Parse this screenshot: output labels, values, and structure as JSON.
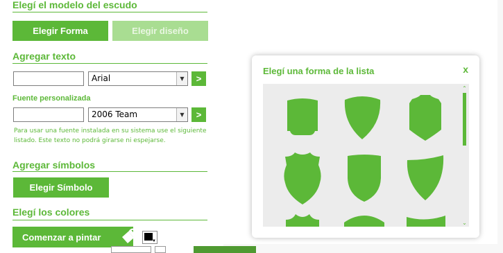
{
  "left_panel": {
    "shape_section": {
      "title": "Elegí el modelo del escudo",
      "shape_button": "Elegir Forma",
      "design_button": "Elegir diseño"
    },
    "text_section": {
      "title": "Agregar texto",
      "text_input_value": "",
      "font_select_value": "Arial",
      "apply_button": ">",
      "custom_font_label": "Fuente personalizada",
      "custom_font_input_value": "",
      "custom_font_select_value": "2006 Team",
      "custom_apply_button": ">",
      "help_text": "Para usar una fuente instalada en su sistema use el siguiente listado. Este texto no podrá girarse ni espejarse."
    },
    "symbol_section": {
      "title": "Agregar símbolos",
      "symbol_button": "Elegir Símbolo"
    },
    "colors_section": {
      "title": "Elegí los colores",
      "paint_button": "Comenzar a pintar"
    }
  },
  "modal": {
    "title": "Elegí una forma de la lista",
    "close_label": "x",
    "shape_color": "#5cb838",
    "shapes": [
      "shield-shape-1",
      "shield-shape-2",
      "shield-shape-3",
      "shield-shape-4",
      "shield-shape-5",
      "shield-shape-6",
      "shield-shape-7",
      "shield-shape-8",
      "shield-shape-9"
    ]
  },
  "colors": {
    "accent": "#5cb838",
    "accent_disabled": "#a9dd92"
  }
}
